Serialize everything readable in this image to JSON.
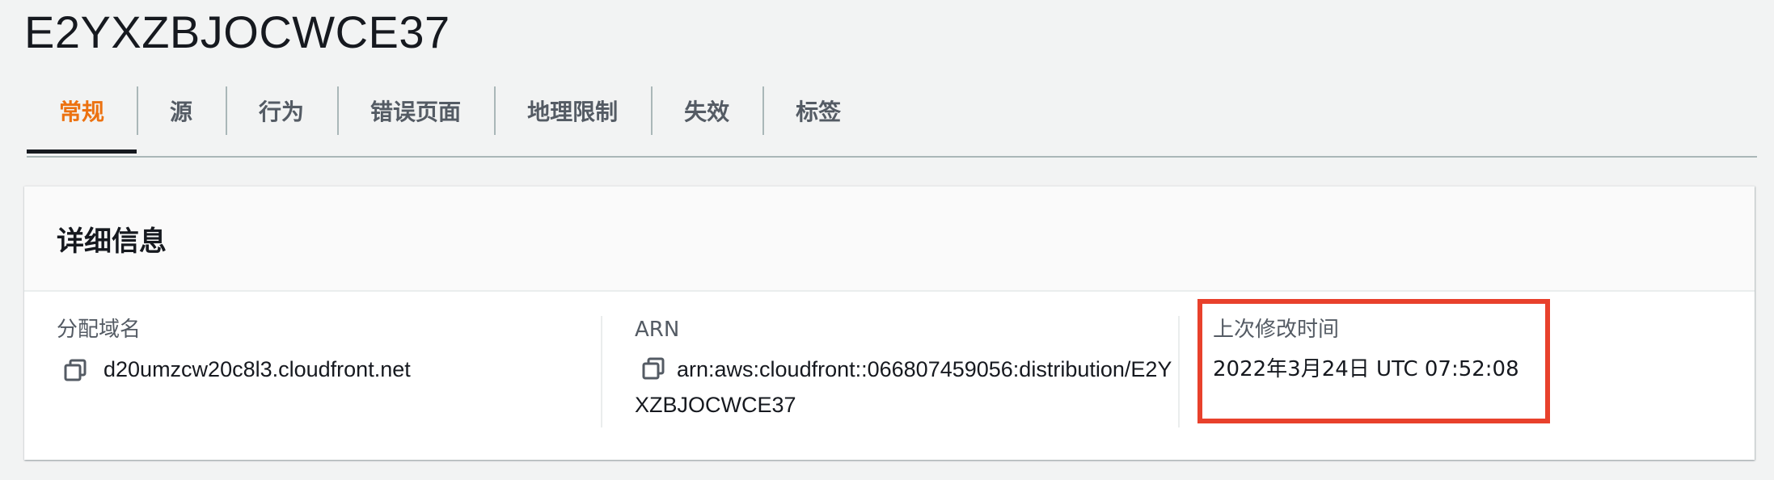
{
  "page": {
    "title": "E2YXZBJOCWCE37"
  },
  "tabs": [
    {
      "label": "常规",
      "active": true
    },
    {
      "label": "源",
      "active": false
    },
    {
      "label": "行为",
      "active": false
    },
    {
      "label": "错误页面",
      "active": false
    },
    {
      "label": "地理限制",
      "active": false
    },
    {
      "label": "失效",
      "active": false
    },
    {
      "label": "标签",
      "active": false
    }
  ],
  "details": {
    "title": "详细信息",
    "domain": {
      "label": "分配域名",
      "value": "d20umzcw20c8l3.cloudfront.net",
      "icon": "copy-icon"
    },
    "arn": {
      "label": "ARN",
      "value": "arn:aws:cloudfront::066807459056:distribution/E2YXZBJOCWCE37",
      "icon": "copy-icon"
    },
    "last_modified": {
      "label": "上次修改时间",
      "value": "2022年3月24日 UTC 07:52:08"
    }
  },
  "colors": {
    "active_tab": "#ec7211",
    "highlight": "#e8412c",
    "background": "#f2f3f3"
  }
}
